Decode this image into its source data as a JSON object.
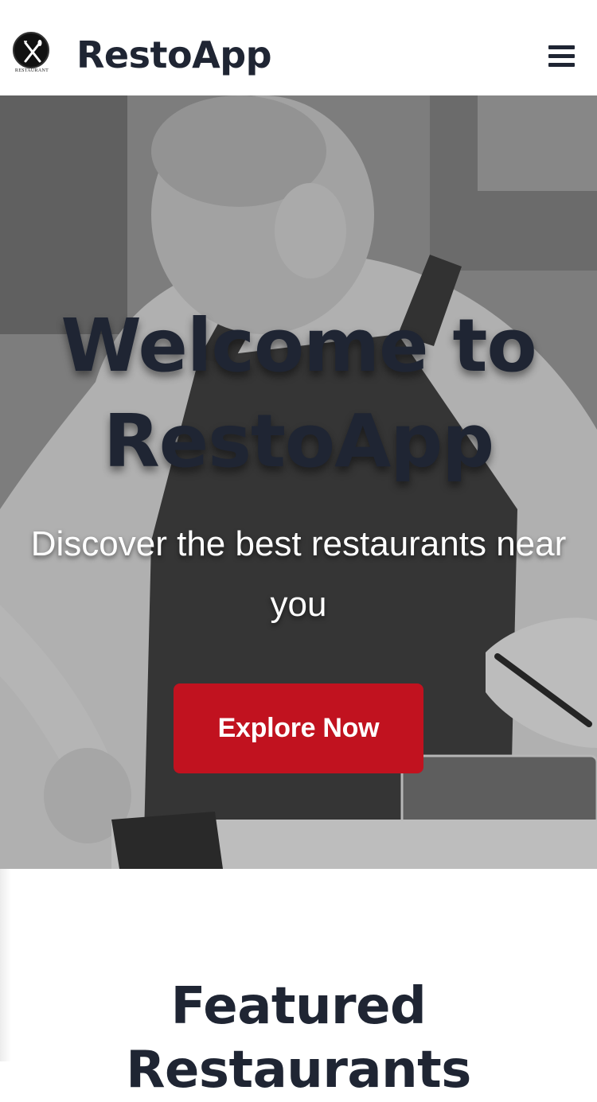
{
  "header": {
    "logo_text": "RESTAURANT",
    "brand": "RestoApp",
    "menu_icon": "hamburger-menu-icon"
  },
  "hero": {
    "title_line1": "Welcome to",
    "title_line2": "RestoApp",
    "subtitle_line1": "Discover the best restaurants near",
    "subtitle_line2": "you",
    "cta_label": "Explore Now"
  },
  "featured": {
    "title": "Featured Restaurants"
  },
  "colors": {
    "brand_dark": "#1f2533",
    "accent_red": "#c1121f",
    "white": "#ffffff"
  }
}
